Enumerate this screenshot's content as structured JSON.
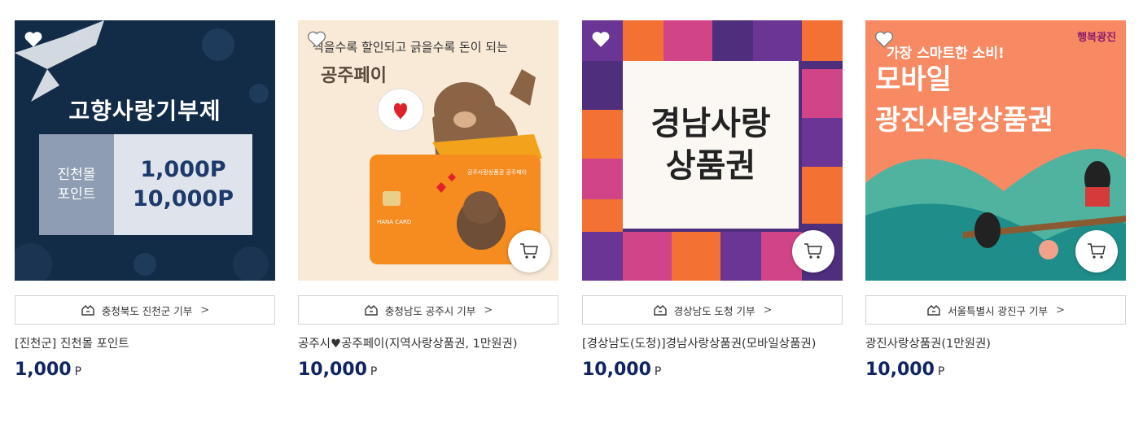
{
  "products": [
    {
      "donate_label": "충청북도 진천군 기부",
      "name": "[진천군] 진천몰 포인트",
      "price": "1,000",
      "unit": "P",
      "image": {
        "title": "고향사랑기부제",
        "ticket_left_line1": "진천몰",
        "ticket_left_line2": "포인트",
        "ticket_value1": "1,000P",
        "ticket_value2": "10,000P"
      }
    },
    {
      "donate_label": "충청남도 공주시 기부",
      "name": "공주시♥공주페이(지역사랑상품권, 1만원권)",
      "price": "10,000",
      "unit": "P",
      "image": {
        "slogan": "찍을수록 할인되고 긁을수록 돈이 되는",
        "brand": "공주페이",
        "card_label": "공주사랑상품권 공주페이",
        "card_brand": "HANA CARD"
      }
    },
    {
      "donate_label": "경상남도 도청 기부",
      "name": "[경상남도(도청)]경남사랑상품권(모바일상품권)",
      "price": "10,000",
      "unit": "P",
      "image": {
        "title_line1": "경남사랑",
        "title_line2": "상품권"
      }
    },
    {
      "donate_label": "서울특별시 광진구 기부",
      "name": "광진사랑상품권(1만원권)",
      "price": "10,000",
      "unit": "P",
      "image": {
        "small_line": "가장 스마트한 소비!",
        "big_line1": "모바일",
        "big_line2": "광진사랑상품권",
        "logo_text": "행복광진"
      }
    }
  ],
  "icons": {
    "wish": "heart-icon",
    "cart": "cart-icon",
    "donate": "donation-box-icon",
    "chevron": "chevron-right-icon"
  }
}
